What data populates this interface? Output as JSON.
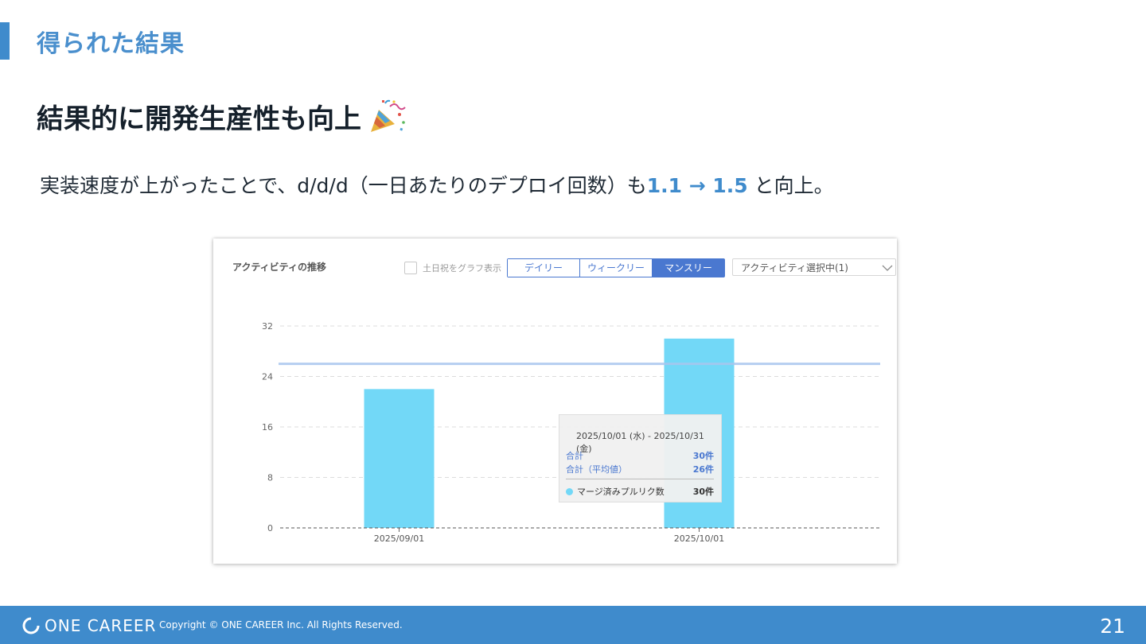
{
  "slide": {
    "section_title": "得られた結果",
    "heading": "結果的に開発生産性も向上",
    "heading_emoji": "party-popper",
    "subtext_before": "実装速度が上がったことで、d/d/d（一日あたりのデプロイ回数）も",
    "subtext_highlight": "1.1 → 1.5",
    "subtext_after": " と向上。",
    "accent_color": "#3f8bcc"
  },
  "panel": {
    "title": "アクティビティの推移",
    "weekend_toggle_label": "土日祝をグラフ表示",
    "weekend_toggle_checked": false,
    "period_tabs": [
      {
        "label": "デイリー",
        "active": false
      },
      {
        "label": "ウィークリー",
        "active": false
      },
      {
        "label": "マンスリー",
        "active": true
      }
    ],
    "activity_select_value": "アクティビティ選択中(1)"
  },
  "chart_data": {
    "type": "bar",
    "categories": [
      "2025/09/01",
      "2025/10/01"
    ],
    "series": [
      {
        "name": "マージ済みプルリク数",
        "values": [
          22,
          30
        ],
        "color": "#72d8f7"
      }
    ],
    "average_line": 26,
    "average_line_color": "#a9c6ee",
    "yticks": [
      0,
      8,
      16,
      24,
      32
    ],
    "ylim": [
      0,
      32
    ],
    "grid": true
  },
  "tooltip": {
    "date_range": "2025/10/01 (水) - 2025/10/31 (金)",
    "total_label": "合計",
    "total_value": "30件",
    "avg_label": "合計（平均値）",
    "avg_value": "26件",
    "series_label": "マージ済みプルリク数",
    "series_value": "30件"
  },
  "footer": {
    "logo_text": "ONE CAREER",
    "copyright": "Copyright © ONE CAREER Inc. All Rights Reserved.",
    "page_number": "21",
    "color": "#3f8bcc"
  }
}
